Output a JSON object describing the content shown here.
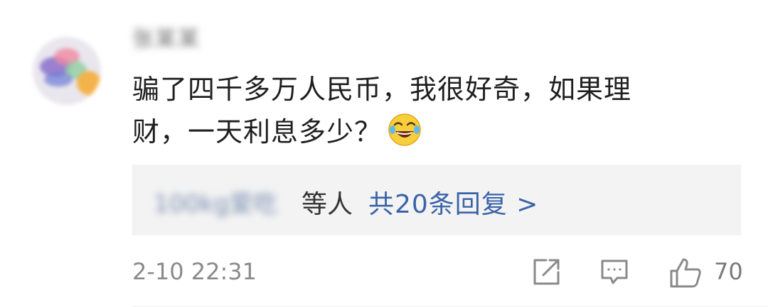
{
  "comment": {
    "username": "张某某",
    "text_line1": "骗了四千多万人民币，我很好奇，如果理",
    "text_line2": "财，一天利息多少？",
    "emoji_icon": "laughing-with-tears-emoji",
    "replies": {
      "names": "100kg爱吃",
      "suffix": "等人",
      "link": "共20条回复 >"
    },
    "timestamp": "2-10 22:31",
    "actions": {
      "share_icon": "share-icon",
      "comment_icon": "comment-icon",
      "like_icon": "thumbs-up-icon",
      "like_count": "70"
    }
  }
}
